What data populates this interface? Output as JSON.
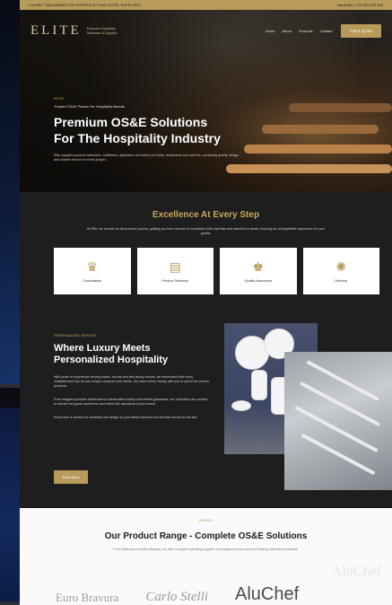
{
  "topbar": {
    "left": "LUXURY TABLEWARE FOR HOSPITALITY AND HOTEL SUPPLIERS",
    "right": "info@elite | +00 000 000 000"
  },
  "nav": {
    "logo": "ELITE",
    "logo_sub": [
      "Exclusive Hospitality",
      "Tableware & Supplies"
    ],
    "links": [
      "Home",
      "About",
      "Products",
      "Contact"
    ],
    "cta": "Get a Quote"
  },
  "hero": {
    "kicker": "ELITE",
    "sub": "Trusted OS&E Partner for Hospitality Brands",
    "title_line1": "Premium OS&E Solutions",
    "title_line2": "For The Hospitality Industry",
    "desc": "Elite supplies premium tableware, buffetware, glassware and cutlery to hotels, restaurants and caterers, combining quality, design and reliable service for every project."
  },
  "excellence": {
    "title": "Excellence At Every Step",
    "desc": "At Elite, we provide an all-inclusive journey, guiding you from concept to completion with expertise and attention to detail, ensuring an unforgettable experience for your guests.",
    "cards": [
      {
        "icon": "crown-icon",
        "glyph": "♛",
        "label": "Consultation"
      },
      {
        "icon": "catalog-icon",
        "glyph": "▤",
        "label": "Product Selection"
      },
      {
        "icon": "trophy-icon",
        "glyph": "♚",
        "label": "Quality Assurance"
      },
      {
        "icon": "gear-icon",
        "glyph": "✺",
        "label": "Delivery"
      }
    ]
  },
  "luxury": {
    "kicker": "PERSONALIZED SERVICE",
    "title_line1": "Where Luxury Meets",
    "title_line2": "Personalized Hospitality",
    "para1": "With years of experience serving hotels, resorts and fine dining venues, we understand that every establishment has its own unique character and needs. Our team works closely with you to select the perfect products.",
    "para2": "From elegant porcelain dinnerware to handcrafted cutlery and refined glassware, our collections are curated to elevate the guest experience and reflect the standards of your brand.",
    "para3": "Every item is chosen for durability and design so your tables impress from the first service to the last.",
    "button": "Read More"
  },
  "range": {
    "kicker": "BRANDS",
    "title": "Our Product Range - Complete OS&E Solutions",
    "desc": "From tableware to buffet displays, we offer complete operating supplies and equipment sourced from leading international brands.",
    "brands": [
      "Euro Bravura",
      "Carlo Stelli",
      "AluChef"
    ],
    "ghost": "AluChef"
  },
  "colors": {
    "gold": "#b89a5b",
    "dark": "#1c1c1c"
  }
}
